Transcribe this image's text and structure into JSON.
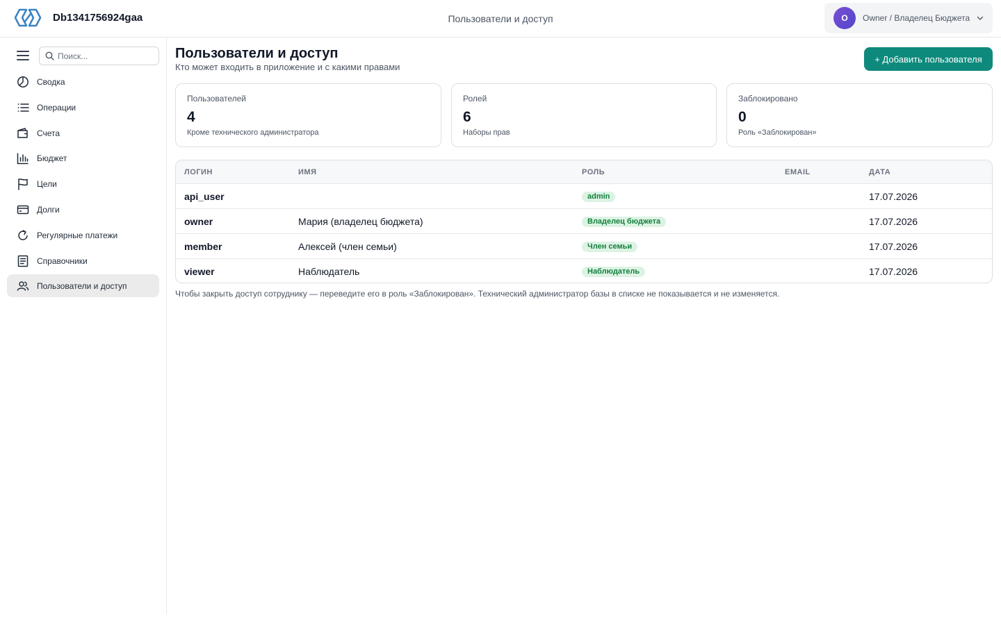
{
  "app": {
    "title": "Db1341756924gaa",
    "header_subtitle": "Пользователи и доступ"
  },
  "user": {
    "initial": "O",
    "name": "Owner / Владелец Бюджета"
  },
  "sidebar": {
    "search_placeholder": "Поиск...",
    "items": [
      {
        "label": "Сводка",
        "icon": "pie-chart-icon"
      },
      {
        "label": "Операции",
        "icon": "list-icon"
      },
      {
        "label": "Счета",
        "icon": "wallet-icon"
      },
      {
        "label": "Бюджет",
        "icon": "bar-chart-icon"
      },
      {
        "label": "Цели",
        "icon": "flag-icon"
      },
      {
        "label": "Долги",
        "icon": "credit-card-icon"
      },
      {
        "label": "Регулярные платежи",
        "icon": "refresh-icon"
      },
      {
        "label": "Справочники",
        "icon": "book-icon"
      },
      {
        "label": "Пользователи и доступ",
        "icon": "users-icon",
        "active": true
      }
    ]
  },
  "page": {
    "title": "Пользователи и доступ",
    "subtitle": "Кто может входить в приложение и с какими правами",
    "add_button": "+ Добавить пользователя"
  },
  "stats": [
    {
      "label": "Пользователей",
      "value": "4",
      "note": "Кроме технического администратора"
    },
    {
      "label": "Ролей",
      "value": "6",
      "note": "Наборы прав"
    },
    {
      "label": "Заблокировано",
      "value": "0",
      "note": "Роль «Заблокирован»"
    }
  ],
  "table": {
    "columns": [
      "Логин",
      "Имя",
      "Роль",
      "Email",
      "Дата"
    ],
    "rows": [
      {
        "login": "api_user",
        "name": "",
        "role": "admin",
        "email": "",
        "date": "17.07.2026"
      },
      {
        "login": "owner",
        "name": "Мария (владелец бюджета)",
        "role": "Владелец бюджета",
        "email": "",
        "date": "17.07.2026"
      },
      {
        "login": "member",
        "name": "Алексей (член семьи)",
        "role": "Член семьи",
        "email": "",
        "date": "17.07.2026"
      },
      {
        "login": "viewer",
        "name": "Наблюдатель",
        "role": "Наблюдатель",
        "email": "",
        "date": "17.07.2026"
      }
    ]
  },
  "footnote": "Чтобы закрыть доступ сотруднику — переведите его в роль «Заблокирован». Технический администратор базы в списке не показывается и не изменяется.",
  "colors": {
    "accent": "#0e8a7c",
    "badge_bg": "#dcf3e4",
    "badge_text": "#15803d",
    "avatar": "#6a4bd0",
    "logo": "#3b82c4"
  }
}
